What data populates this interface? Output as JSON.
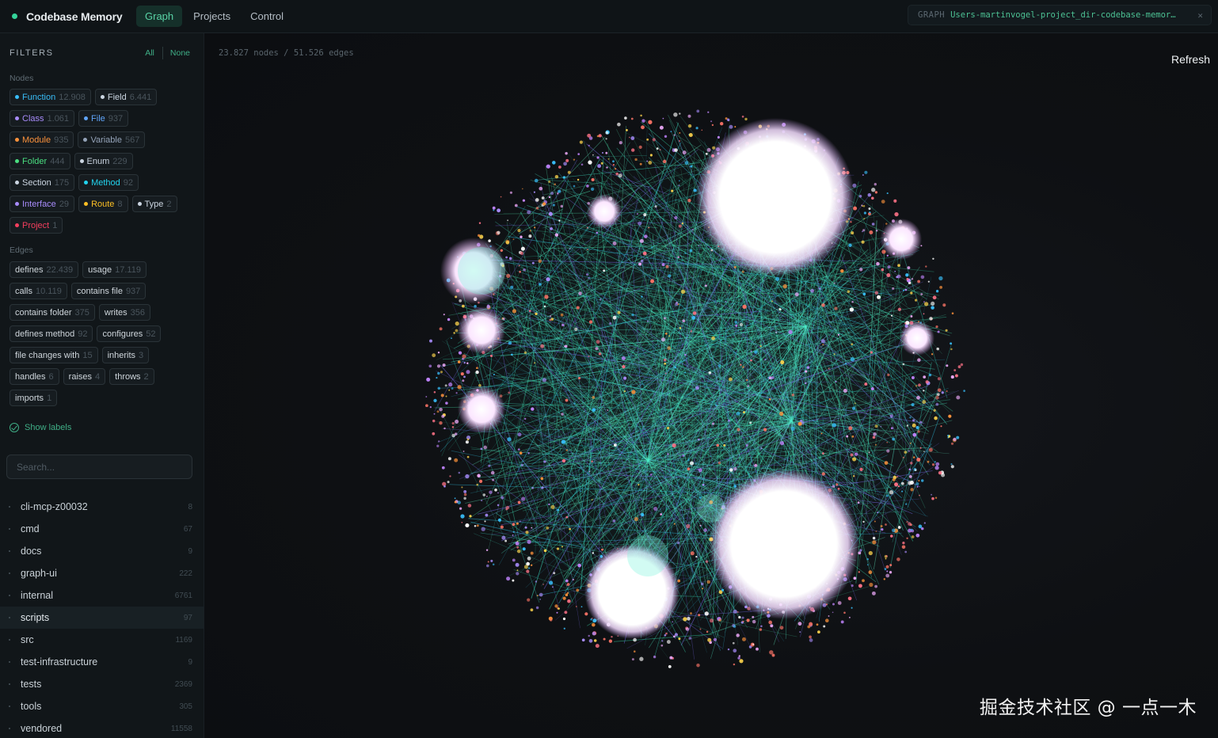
{
  "app": {
    "title": "Codebase Memory",
    "accent": "#34d399"
  },
  "tabs": [
    {
      "label": "Graph",
      "active": true
    },
    {
      "label": "Projects",
      "active": false
    },
    {
      "label": "Control",
      "active": false
    }
  ],
  "graph_chip": {
    "label": "GRAPH",
    "value": "Users-martinvogel-project_dir-codebase-memor…",
    "close_icon": "close-icon"
  },
  "filters": {
    "title": "FILTERS",
    "all_label": "All",
    "none_label": "None",
    "nodes_label": "Nodes",
    "edges_label": "Edges",
    "node_types": [
      {
        "label": "Function",
        "count": "12.908",
        "color": "#38bdf8"
      },
      {
        "label": "Field",
        "count": "6.441",
        "color": "#cbd5e1"
      },
      {
        "label": "Class",
        "count": "1.061",
        "color": "#a78bfa"
      },
      {
        "label": "File",
        "count": "937",
        "color": "#60a5fa"
      },
      {
        "label": "Module",
        "count": "935",
        "color": "#fb923c"
      },
      {
        "label": "Variable",
        "count": "567",
        "color": "#94a3b8"
      },
      {
        "label": "Folder",
        "count": "444",
        "color": "#4ade80"
      },
      {
        "label": "Enum",
        "count": "229",
        "color": "#cbd5e1"
      },
      {
        "label": "Section",
        "count": "175",
        "color": "#cbd5e1"
      },
      {
        "label": "Method",
        "count": "92",
        "color": "#22d3ee"
      },
      {
        "label": "Interface",
        "count": "29",
        "color": "#a78bfa"
      },
      {
        "label": "Route",
        "count": "8",
        "color": "#fbbf24"
      },
      {
        "label": "Type",
        "count": "2",
        "color": "#cbd5e1"
      },
      {
        "label": "Project",
        "count": "1",
        "color": "#f43f5e"
      }
    ],
    "edge_types": [
      {
        "label": "defines",
        "count": "22.439"
      },
      {
        "label": "usage",
        "count": "17.119"
      },
      {
        "label": "calls",
        "count": "10.119"
      },
      {
        "label": "contains file",
        "count": "937"
      },
      {
        "label": "contains folder",
        "count": "375"
      },
      {
        "label": "writes",
        "count": "356"
      },
      {
        "label": "defines method",
        "count": "92"
      },
      {
        "label": "configures",
        "count": "52"
      },
      {
        "label": "file changes with",
        "count": "15"
      },
      {
        "label": "inherits",
        "count": "3"
      },
      {
        "label": "handles",
        "count": "6"
      },
      {
        "label": "raises",
        "count": "4"
      },
      {
        "label": "throws",
        "count": "2"
      },
      {
        "label": "imports",
        "count": "1"
      }
    ],
    "show_labels": "Show labels"
  },
  "search": {
    "placeholder": "Search..."
  },
  "tree": [
    {
      "name": "cli-mcp-z00032",
      "count": "8"
    },
    {
      "name": "cmd",
      "count": "67"
    },
    {
      "name": "docs",
      "count": "9"
    },
    {
      "name": "graph-ui",
      "count": "222"
    },
    {
      "name": "internal",
      "count": "6761"
    },
    {
      "name": "scripts",
      "count": "97",
      "active": true
    },
    {
      "name": "src",
      "count": "1169"
    },
    {
      "name": "test-infrastructure",
      "count": "9"
    },
    {
      "name": "tests",
      "count": "2369"
    },
    {
      "name": "tools",
      "count": "305"
    },
    {
      "name": "vendored",
      "count": "11558"
    }
  ],
  "canvas": {
    "stats": "23.827 nodes / 51.526 edges",
    "refresh_label": "Refresh"
  },
  "watermark": "掘金技术社区 @ 一点一木"
}
